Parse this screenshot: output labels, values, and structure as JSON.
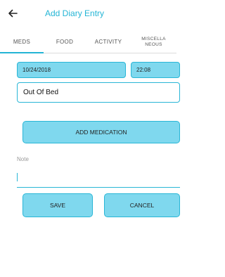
{
  "header": {
    "title": "Add Diary Entry",
    "back_icon": "arrow-left-icon"
  },
  "tabs": [
    {
      "label": "MEDS",
      "active": true
    },
    {
      "label": "FOOD",
      "active": false
    },
    {
      "label": "ACTIVITY",
      "active": false
    },
    {
      "label": "MISCELLANEOUS",
      "line1": "MISCELLA",
      "line2": "NEOUS",
      "active": false
    }
  ],
  "form": {
    "date_value": "10/24/2018",
    "time_value": "22:08",
    "status_value": "Out Of Bed",
    "add_medication_label": "ADD MEDICATION",
    "note_label": "Note",
    "note_value": "",
    "save_label": "SAVE",
    "cancel_label": "CANCEL"
  },
  "colors": {
    "accent": "#24b5d5",
    "button_fill": "#7fd8ee"
  }
}
